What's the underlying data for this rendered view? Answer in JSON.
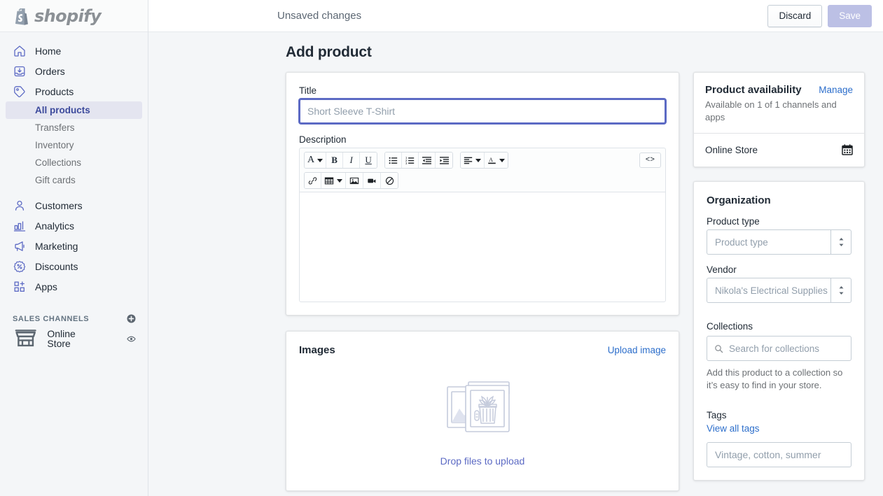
{
  "brand": {
    "name": "shopify",
    "logo_icon": "shopify-bag-logo"
  },
  "sidebar": {
    "items": [
      {
        "label": "Home",
        "icon": "home-icon"
      },
      {
        "label": "Orders",
        "icon": "orders-inbox-icon"
      },
      {
        "label": "Products",
        "icon": "products-tag-icon"
      }
    ],
    "product_subitems": [
      {
        "label": "All products",
        "active": true
      },
      {
        "label": "Transfers",
        "active": false
      },
      {
        "label": "Inventory",
        "active": false
      },
      {
        "label": "Collections",
        "active": false
      },
      {
        "label": "Gift cards",
        "active": false
      }
    ],
    "items_lower": [
      {
        "label": "Customers",
        "icon": "customers-person-icon"
      },
      {
        "label": "Analytics",
        "icon": "analytics-bars-icon"
      },
      {
        "label": "Marketing",
        "icon": "marketing-megaphone-icon"
      },
      {
        "label": "Discounts",
        "icon": "discounts-badge-icon"
      },
      {
        "label": "Apps",
        "icon": "apps-grid-plus-icon"
      }
    ],
    "sales_channels": {
      "heading": "SALES CHANNELS",
      "add_icon": "plus-circle-icon",
      "items": [
        {
          "label": "Online Store",
          "icon": "online-store-icon",
          "action_icon": "eye-icon"
        }
      ]
    }
  },
  "topbar": {
    "status_text": "Unsaved changes",
    "discard_label": "Discard",
    "save_label": "Save",
    "save_disabled": true
  },
  "page": {
    "title": "Add product"
  },
  "product_form": {
    "title_label": "Title",
    "title_value": "",
    "title_placeholder": "Short Sleeve T-Shirt",
    "description_label": "Description",
    "description_value": "",
    "toolbar": {
      "row1": [
        {
          "name": "font-style-button",
          "glyph": "A",
          "dropdown": true
        },
        {
          "name": "bold-button",
          "glyph": "B",
          "dropdown": false
        },
        {
          "name": "italic-button",
          "glyph": "I",
          "dropdown": false
        },
        {
          "name": "underline-button",
          "glyph": "U",
          "dropdown": false
        }
      ],
      "row1b": [
        {
          "name": "bulleted-list-button",
          "icon": "bulleted-list-icon"
        },
        {
          "name": "numbered-list-button",
          "icon": "numbered-list-icon"
        },
        {
          "name": "outdent-button",
          "icon": "outdent-icon"
        },
        {
          "name": "indent-button",
          "icon": "indent-icon"
        }
      ],
      "row1c": [
        {
          "name": "align-button",
          "icon": "align-left-icon",
          "dropdown": true
        },
        {
          "name": "text-color-button",
          "icon": "text-color-icon",
          "dropdown": true
        }
      ],
      "code_button": {
        "name": "show-html-button",
        "label": "<>"
      },
      "row2": [
        {
          "name": "insert-link-button",
          "icon": "link-icon"
        },
        {
          "name": "insert-table-button",
          "icon": "table-icon",
          "dropdown": true
        },
        {
          "name": "insert-image-button",
          "icon": "image-icon"
        },
        {
          "name": "insert-video-button",
          "icon": "video-icon"
        },
        {
          "name": "clear-formatting-button",
          "icon": "no-formatting-icon"
        }
      ]
    }
  },
  "images_card": {
    "title": "Images",
    "upload_link": "Upload image",
    "drop_text": "Drop files to upload",
    "illustration": "two-photo-frames-with-plant"
  },
  "availability_card": {
    "title": "Product availability",
    "manage_link": "Manage",
    "subtitle": "Available on 1 of 1 channels and apps",
    "channels": [
      {
        "name": "Online Store",
        "icon": "calendar-icon"
      }
    ]
  },
  "organization_card": {
    "title": "Organization",
    "product_type": {
      "label": "Product type",
      "value": "",
      "placeholder": "Product type"
    },
    "vendor": {
      "label": "Vendor",
      "value": "",
      "placeholder": "Nikola's Electrical Supplies"
    },
    "collections": {
      "label": "Collections",
      "search_placeholder": "Search for collections",
      "search_icon": "search-icon",
      "help_text": "Add this product to a collection so it’s easy to find in your store."
    },
    "tags": {
      "label": "Tags",
      "view_all_link": "View all tags",
      "placeholder": "Vintage, cotton, summer",
      "value": ""
    }
  },
  "colors": {
    "accent_purple": "#5c6ac4",
    "link_blue": "#2c6ecb",
    "page_bg": "#f4f6f8",
    "sidebar_active_bg": "#e4e5f0",
    "save_disabled_bg": "#bcc0e5"
  }
}
